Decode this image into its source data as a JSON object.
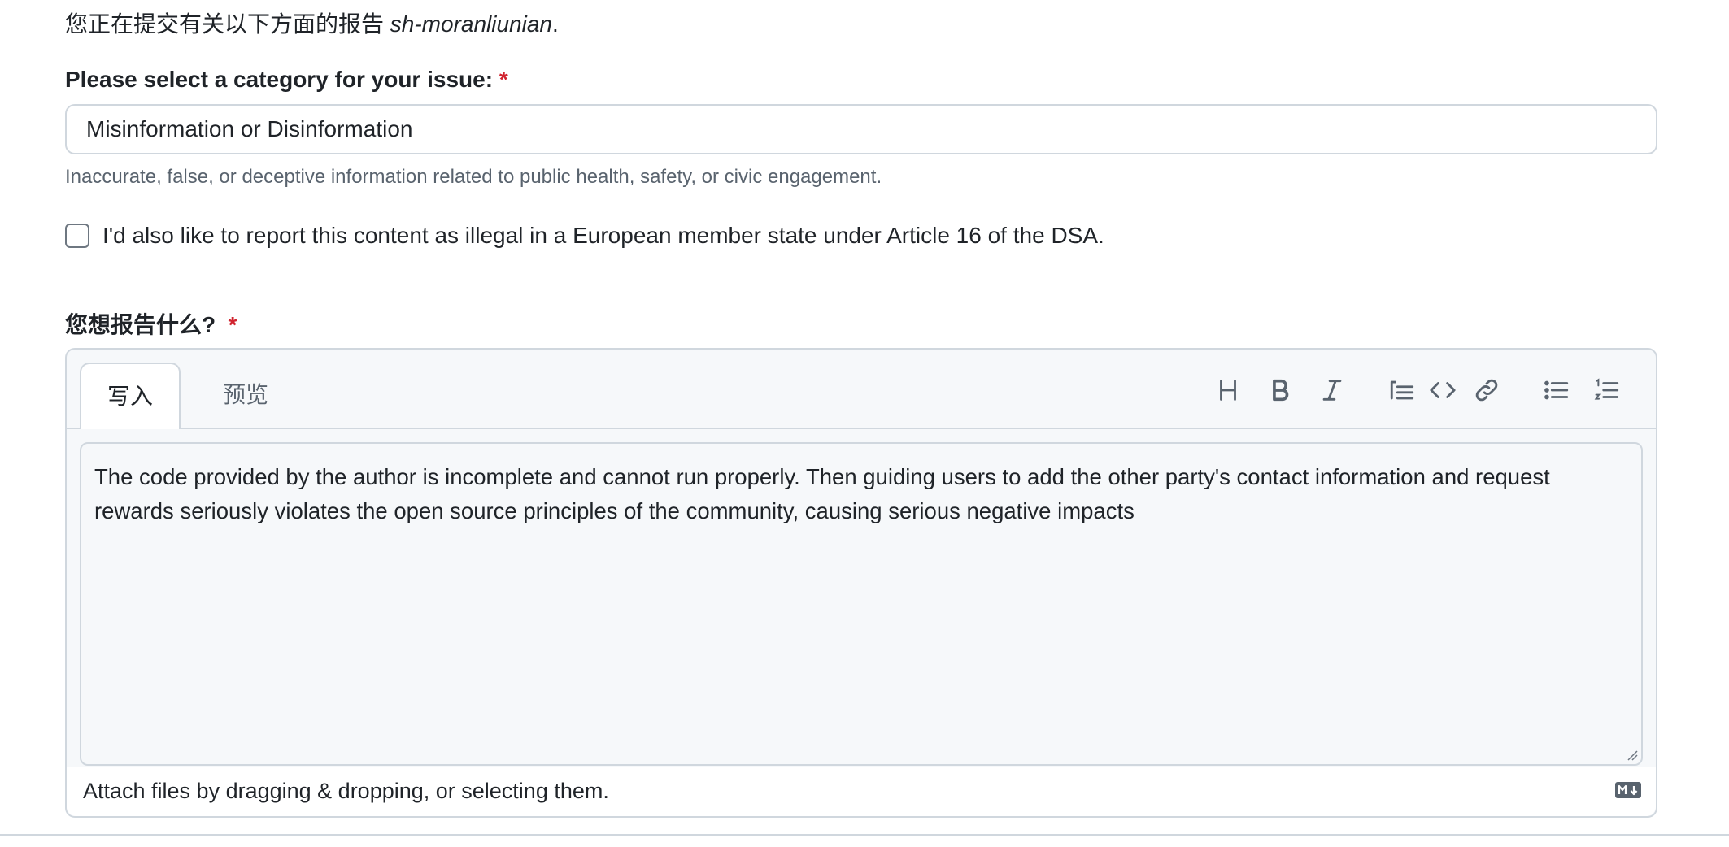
{
  "intro": {
    "prefix": "您正在提交有关以下方面的报告 ",
    "username": "sh-moranliunian",
    "suffix": "."
  },
  "category": {
    "label": "Please select a category for your issue: ",
    "required_mark": "*",
    "selected_value": "Misinformation or Disinformation",
    "hint": "Inaccurate, false, or deceptive information related to public health, safety, or civic engagement."
  },
  "dsa": {
    "checked": false,
    "label": "I'd also like to report this content as illegal in a European member state under Article 16 of the DSA."
  },
  "report": {
    "label": "您想报告什么?",
    "required_mark": "*",
    "tabs": [
      {
        "label": "写入",
        "active": true
      },
      {
        "label": "预览",
        "active": false
      }
    ],
    "toolbar": [
      "heading-icon",
      "bold-icon",
      "italic-icon",
      "quote-icon",
      "code-icon",
      "link-icon",
      "unordered-list-icon",
      "ordered-list-icon"
    ],
    "text": "The code provided by the author is incomplete and cannot run properly. Then guiding users to add the other party's contact information and request rewards seriously violates the open source principles of the community, causing serious negative impacts",
    "attach_hint": "Attach files by dragging & dropping, or selecting them.",
    "markdown_icon": "markdown-icon"
  },
  "colors": {
    "required": "#d1242f",
    "border": "#d0d7de",
    "muted": "#59636e",
    "editor_bg": "#f6f8fa",
    "icon": "#59636e"
  }
}
